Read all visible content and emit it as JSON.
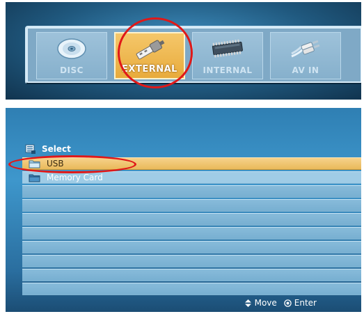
{
  "source_menu": {
    "items": [
      {
        "label": "DISC",
        "icon": "disc-icon",
        "selected": false
      },
      {
        "label": "EXTERNAL",
        "icon": "usb-plug-icon",
        "selected": true
      },
      {
        "label": "INTERNAL",
        "icon": "memory-chip-icon",
        "selected": false
      },
      {
        "label": "AV IN",
        "icon": "av-cable-icon",
        "selected": false
      }
    ]
  },
  "browser": {
    "header_label": "Select",
    "rows": [
      {
        "label": "USB",
        "icon": "folder-icon",
        "selected": true
      },
      {
        "label": "Memory Card",
        "icon": "folder-icon",
        "selected": false
      },
      {
        "label": ""
      },
      {
        "label": ""
      },
      {
        "label": ""
      },
      {
        "label": ""
      },
      {
        "label": ""
      },
      {
        "label": ""
      },
      {
        "label": ""
      },
      {
        "label": ""
      }
    ],
    "footer": {
      "move_label": "Move",
      "enter_label": "Enter"
    }
  },
  "colors": {
    "selection": "#e9b95a",
    "annotation_circle": "#e01818"
  }
}
